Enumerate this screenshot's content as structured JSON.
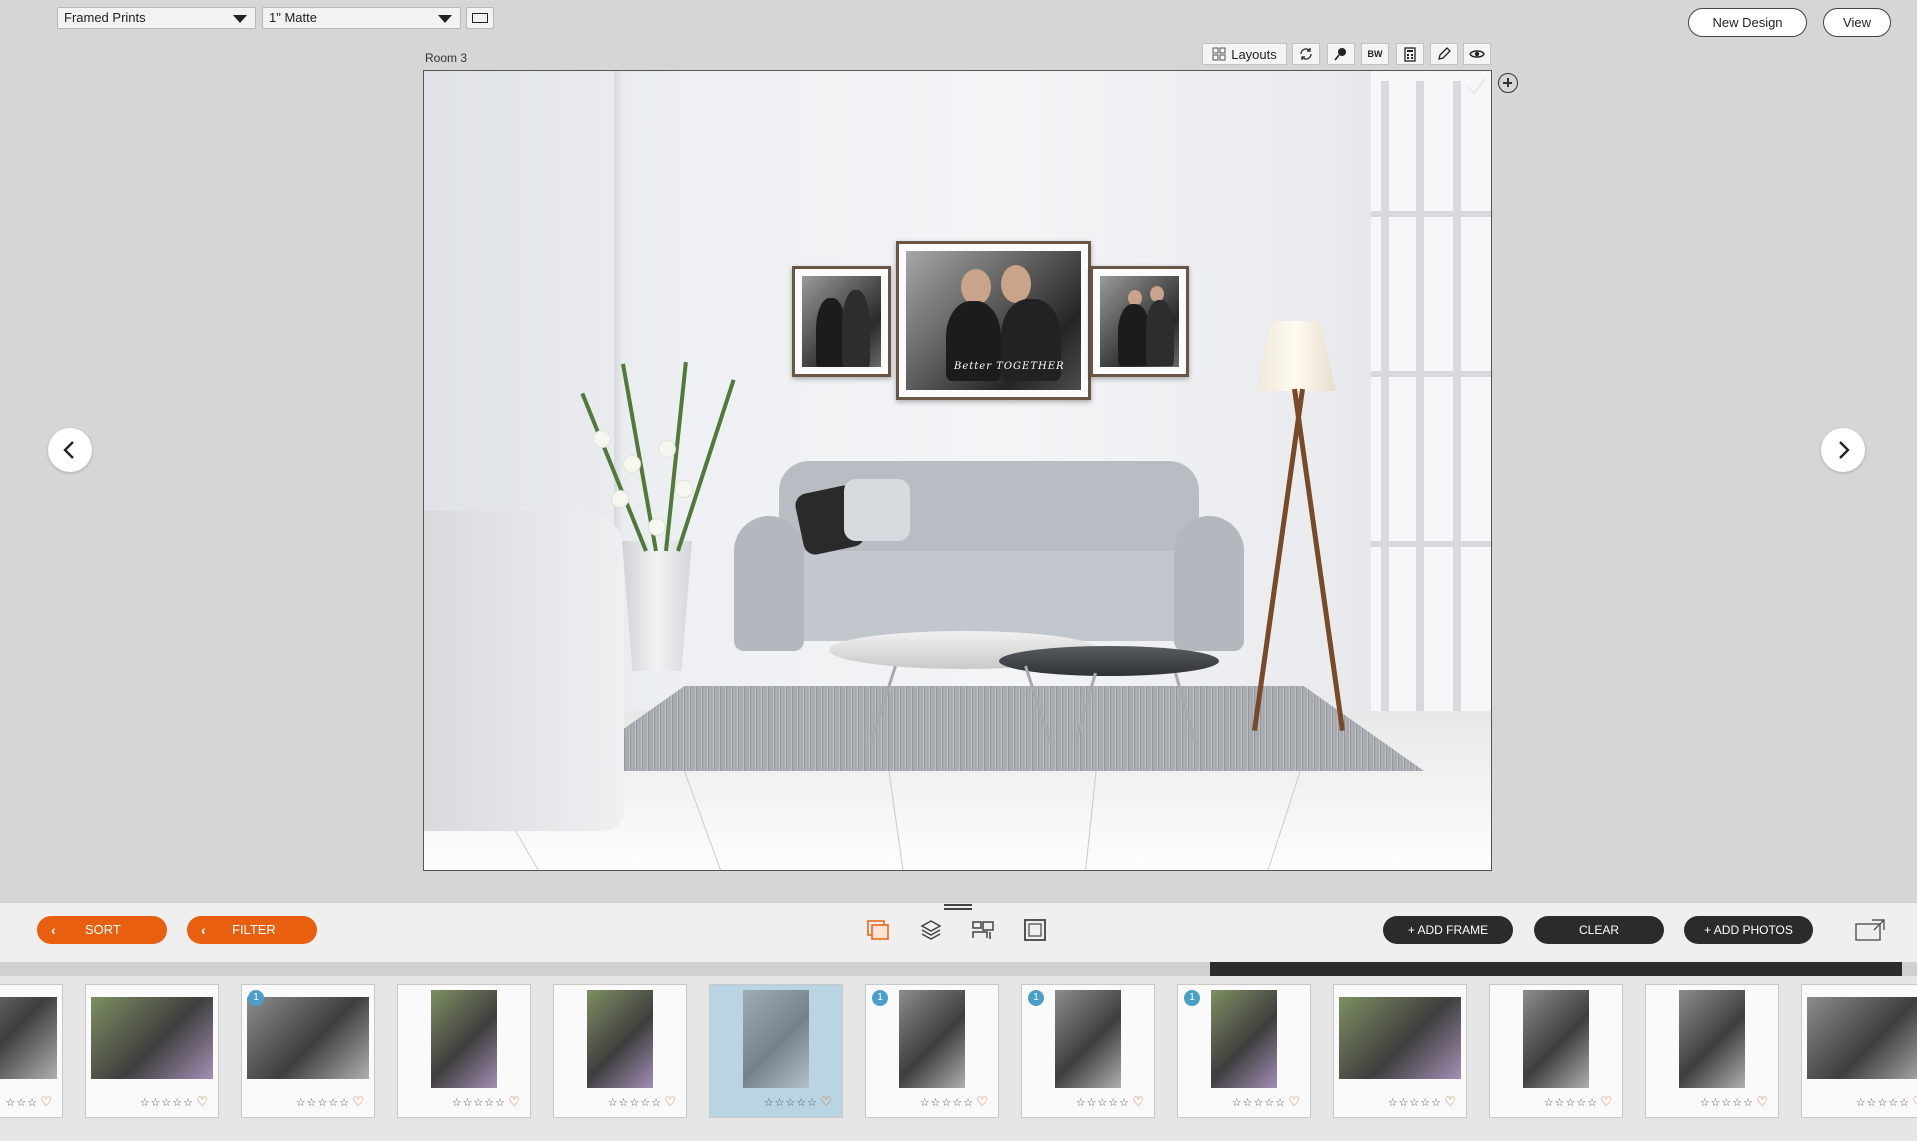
{
  "toolbar": {
    "product_select": "Framed Prints",
    "matte_select": "1\" Matte",
    "new_design_label": "New Design",
    "view_label": "View"
  },
  "canvas": {
    "room_label": "Room 3",
    "layouts_label": "Layouts",
    "bw_label": "BW",
    "frame_caption": "Better TOGETHER"
  },
  "actions": {
    "sort_label": "SORT",
    "filter_label": "FILTER",
    "add_frame_label": "+ ADD FRAME",
    "clear_label": "CLEAR",
    "add_photos_label": "+ ADD PHOTOS"
  },
  "colors": {
    "accent": "#e8600f",
    "dark_button": "#2b2b2b",
    "badge": "#4b9fc7",
    "selected_thumb": "#b9d4e3"
  },
  "thumbnails": [
    {
      "kind": "landscape",
      "badge": "",
      "stars": "☆☆☆",
      "selected": false
    },
    {
      "kind": "landscape-color",
      "badge": "",
      "stars": "☆☆☆☆☆",
      "selected": false
    },
    {
      "kind": "landscape",
      "badge": "1",
      "stars": "☆☆☆☆☆",
      "selected": false
    },
    {
      "kind": "portrait-color",
      "badge": "",
      "stars": "☆☆☆☆☆",
      "selected": false
    },
    {
      "kind": "portrait-color",
      "badge": "",
      "stars": "☆☆☆☆☆",
      "selected": false
    },
    {
      "kind": "portrait",
      "badge": "",
      "stars": "☆☆☆☆☆",
      "selected": true
    },
    {
      "kind": "portrait",
      "badge": "1",
      "stars": "☆☆☆☆☆",
      "selected": false
    },
    {
      "kind": "portrait",
      "badge": "1",
      "stars": "☆☆☆☆☆",
      "selected": false
    },
    {
      "kind": "portrait-color",
      "badge": "1",
      "stars": "☆☆☆☆☆",
      "selected": false
    },
    {
      "kind": "landscape-color",
      "badge": "",
      "stars": "☆☆☆☆☆",
      "selected": false
    },
    {
      "kind": "portrait",
      "badge": "",
      "stars": "☆☆☆☆☆",
      "selected": false
    },
    {
      "kind": "portrait",
      "badge": "",
      "stars": "☆☆☆☆☆",
      "selected": false
    },
    {
      "kind": "landscape",
      "badge": "",
      "stars": "☆☆☆☆☆",
      "selected": false
    }
  ]
}
